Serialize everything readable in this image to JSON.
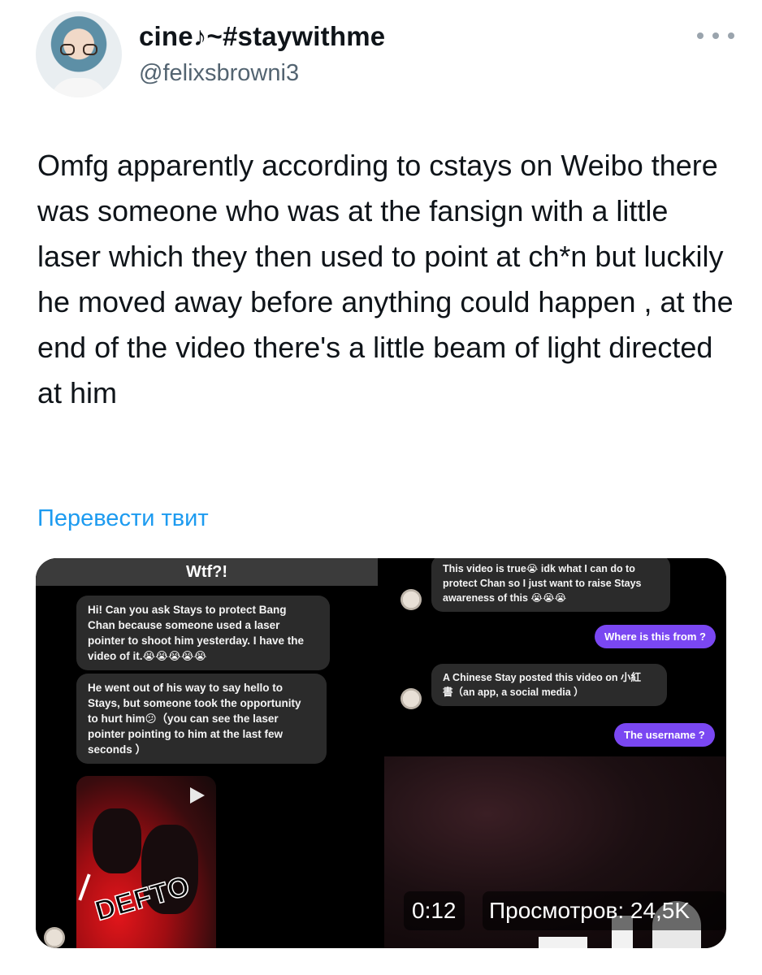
{
  "author": {
    "display_name": "cine♪~#staywithme",
    "handle": "@felixsbrowni3"
  },
  "tweet": {
    "text": "Omfg apparently according to cstays on Weibo there was someone who was at the fansign with a little laser which they then used to point at ch*n but luckily he moved away before anything could happen , at the end of the video there's a little beam of light directed at him",
    "translate_label": "Перевести твит"
  },
  "media": {
    "left": {
      "header": "Wtf?!",
      "bubble1": "Hi! Can you ask Stays to protect Bang\nChan because someone used a laser\npointer to shoot him yesterday. I have the\nvideo of it.😭😭😭😭😭",
      "bubble2": "He went out of his way to say hello to\nStays, but someone took the opportunity\nto hurt him😕（you can see the laser\npointer pointing to him at the last few\nseconds ）",
      "thumb_text": "DEFTO"
    },
    "right_top": {
      "msg1": "This video is true😭 idk what I can do to\nprotect Chan so I just want to raise Stays\nawareness of this 😭😭😭",
      "reply1": "Where is this from ?",
      "msg2": "A Chinese Stay posted this video on 小紅\n書（an app, a social media ）",
      "reply2": "The username ?"
    },
    "video": {
      "time": "0:12",
      "views": "Просмотров: 24,5K"
    }
  },
  "colors": {
    "link": "#1d9bf0",
    "outgoing_bubble": "#7a47f2"
  },
  "icons": {
    "more": "more-horizontal-icon",
    "play": "play-icon"
  }
}
